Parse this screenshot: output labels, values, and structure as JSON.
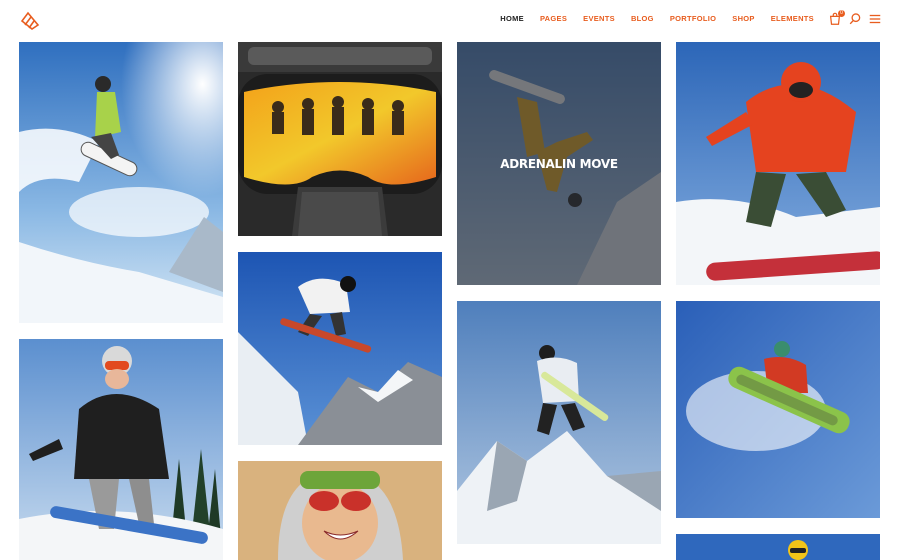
{
  "nav": {
    "items": [
      {
        "label": "HOME",
        "active": true
      },
      {
        "label": "PAGES",
        "active": false
      },
      {
        "label": "EVENTS",
        "active": false
      },
      {
        "label": "BLOG",
        "active": false
      },
      {
        "label": "PORTFOLIO",
        "active": false
      },
      {
        "label": "SHOP",
        "active": false
      },
      {
        "label": "ELEMENTS",
        "active": false
      }
    ],
    "cart_count": "0",
    "icons": [
      "cart-icon",
      "search-icon",
      "menu-icon"
    ]
  },
  "colors": {
    "accent": "#e85d1f",
    "nav_active": "#222222",
    "overlay": "#3c4048"
  },
  "gallery": {
    "hover_title": "ADRENALIN MOVE",
    "tiles": [
      {
        "name": "snowboarder-sunburst"
      },
      {
        "name": "ski-goggles-reflection"
      },
      {
        "name": "adrenalin-move-jump"
      },
      {
        "name": "red-jacket-snowboarder"
      },
      {
        "name": "snowboarder-helmet-riding"
      },
      {
        "name": "snowboarder-mid-air"
      },
      {
        "name": "snowboarder-white-jacket"
      },
      {
        "name": "snowboarder-green-board"
      },
      {
        "name": "woman-red-goggles"
      },
      {
        "name": "snowboarder-yellow-helmet"
      }
    ]
  }
}
